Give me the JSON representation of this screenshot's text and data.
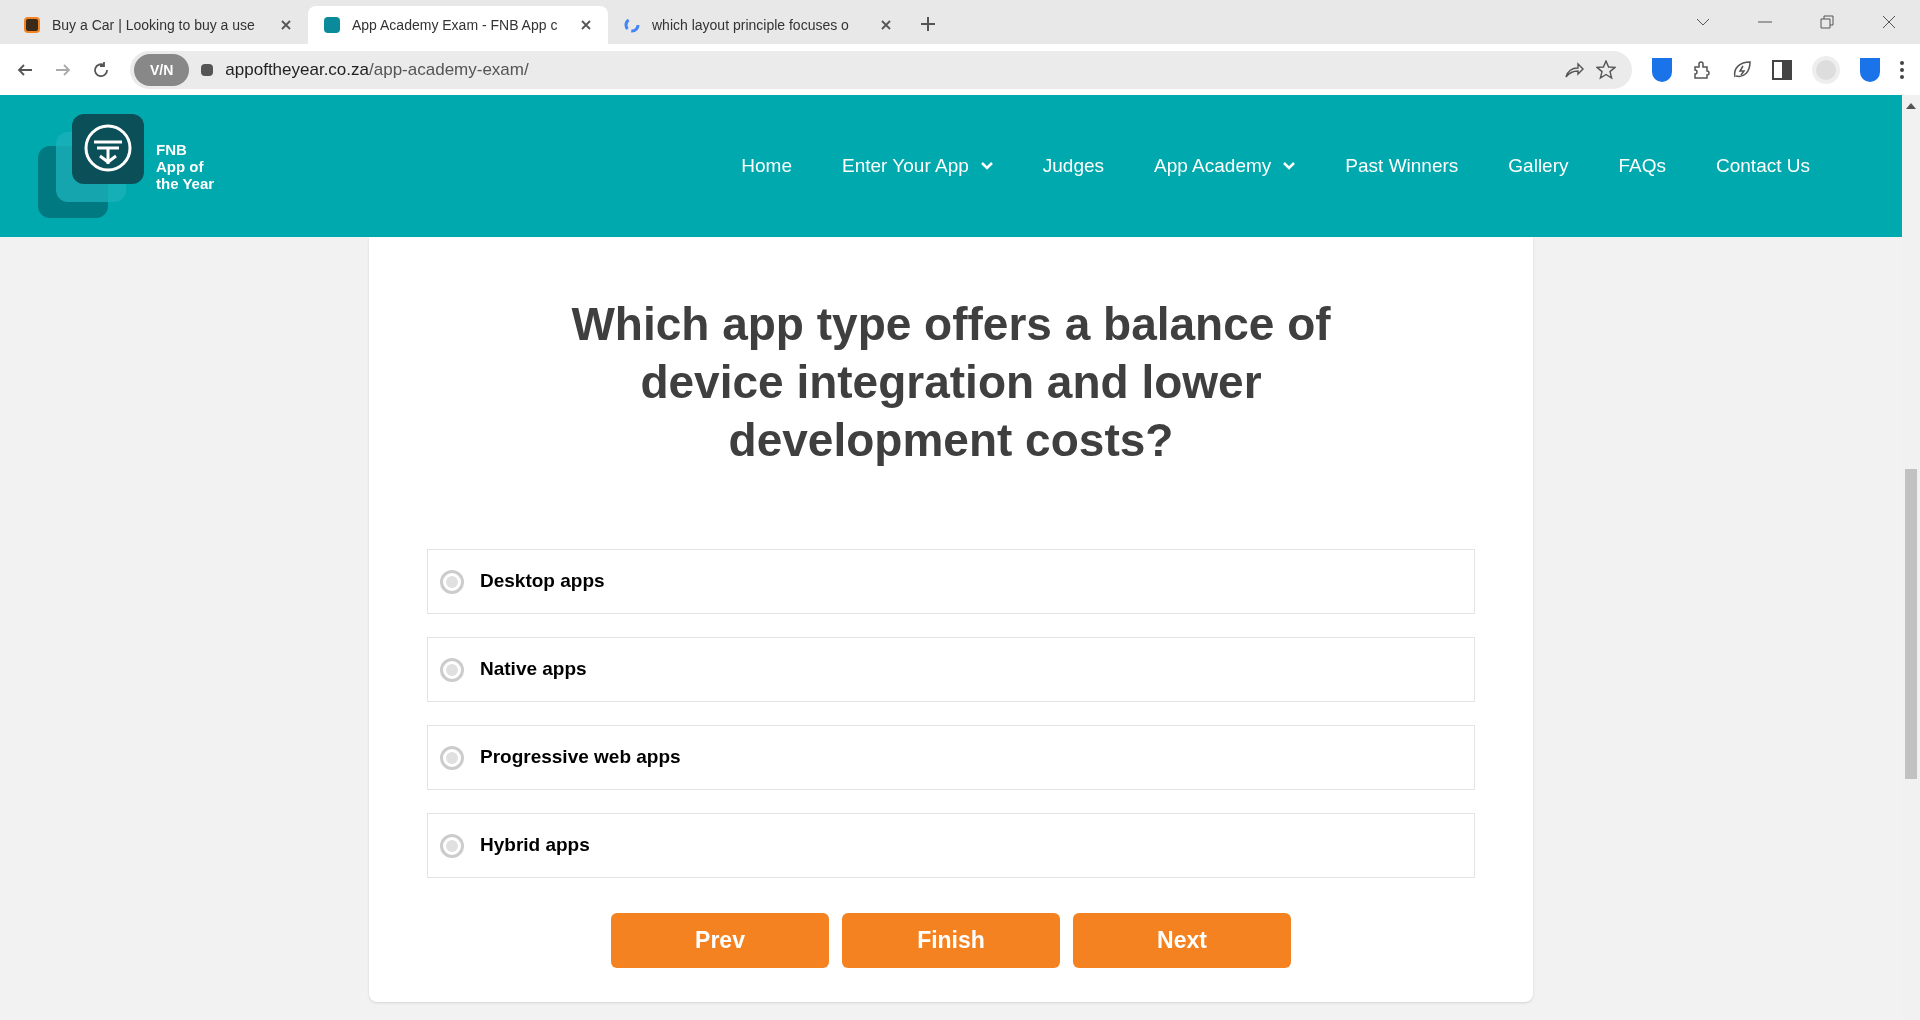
{
  "browser": {
    "tabs": [
      {
        "title": "Buy a Car | Looking to buy a use",
        "selected": false,
        "kind": "car"
      },
      {
        "title": "App Academy Exam - FNB App c",
        "selected": true,
        "kind": "site"
      },
      {
        "title": "which layout principle focuses o",
        "selected": false,
        "kind": "google"
      }
    ],
    "vpn_badge": "V/N",
    "url_domain": "appoftheyear.co.za",
    "url_path": "/app-academy-exam/"
  },
  "header": {
    "logo_lines": [
      "FNB",
      "App of",
      "the Year"
    ],
    "nav": [
      {
        "label": "Home",
        "dropdown": false
      },
      {
        "label": "Enter Your App",
        "dropdown": true
      },
      {
        "label": "Judges",
        "dropdown": false
      },
      {
        "label": "App Academy",
        "dropdown": true
      },
      {
        "label": "Past Winners",
        "dropdown": false
      },
      {
        "label": "Gallery",
        "dropdown": false
      },
      {
        "label": "FAQs",
        "dropdown": false
      },
      {
        "label": "Contact Us",
        "dropdown": false
      }
    ]
  },
  "question": "Which app type offers a balance of device integration and lower development costs?",
  "options": [
    {
      "label": "Desktop apps",
      "selected": false
    },
    {
      "label": "Native apps",
      "selected": false
    },
    {
      "label": "Progressive web apps",
      "selected": false
    },
    {
      "label": "Hybrid apps",
      "selected": false
    }
  ],
  "buttons": [
    "Prev",
    "Finish",
    "Next"
  ]
}
